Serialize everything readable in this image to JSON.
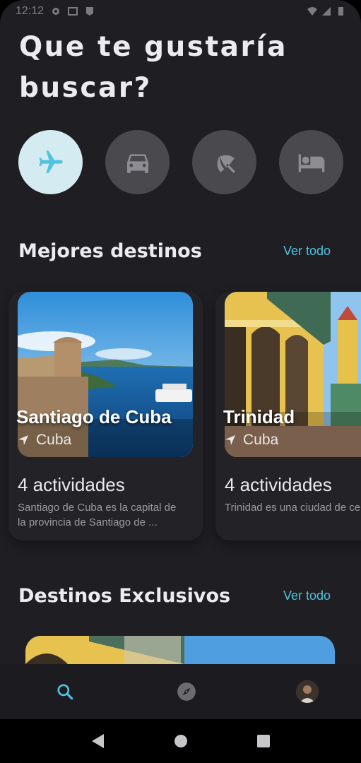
{
  "status": {
    "time": "12:12"
  },
  "header": {
    "title": "Que te gustaría buscar?"
  },
  "categories": [
    {
      "icon": "airplane-icon",
      "active": true
    },
    {
      "icon": "car-icon",
      "active": false
    },
    {
      "icon": "beach-umbrella-icon",
      "active": false
    },
    {
      "icon": "bed-icon",
      "active": false
    }
  ],
  "best": {
    "title": "Mejores destinos",
    "see_all": "Ver todo",
    "cards": [
      {
        "name": "Santiago de Cuba",
        "location": "Cuba",
        "activities": "4 actividades",
        "description": "Santiago de Cuba es la capital de la provincia de Santiago de ..."
      },
      {
        "name": "Trinidad",
        "location": "Cuba",
        "activities": "4 actividades",
        "description": "Trinidad es una ciudad de centro de Cuba, conocida"
      }
    ]
  },
  "exclusive": {
    "title": "Destinos Exclusivos",
    "see_all": "Ver todo"
  },
  "colors": {
    "accent": "#4fc3df",
    "background": "#1f1e23",
    "category_inactive": "#4a494e",
    "category_active": "#d4ecf1"
  }
}
